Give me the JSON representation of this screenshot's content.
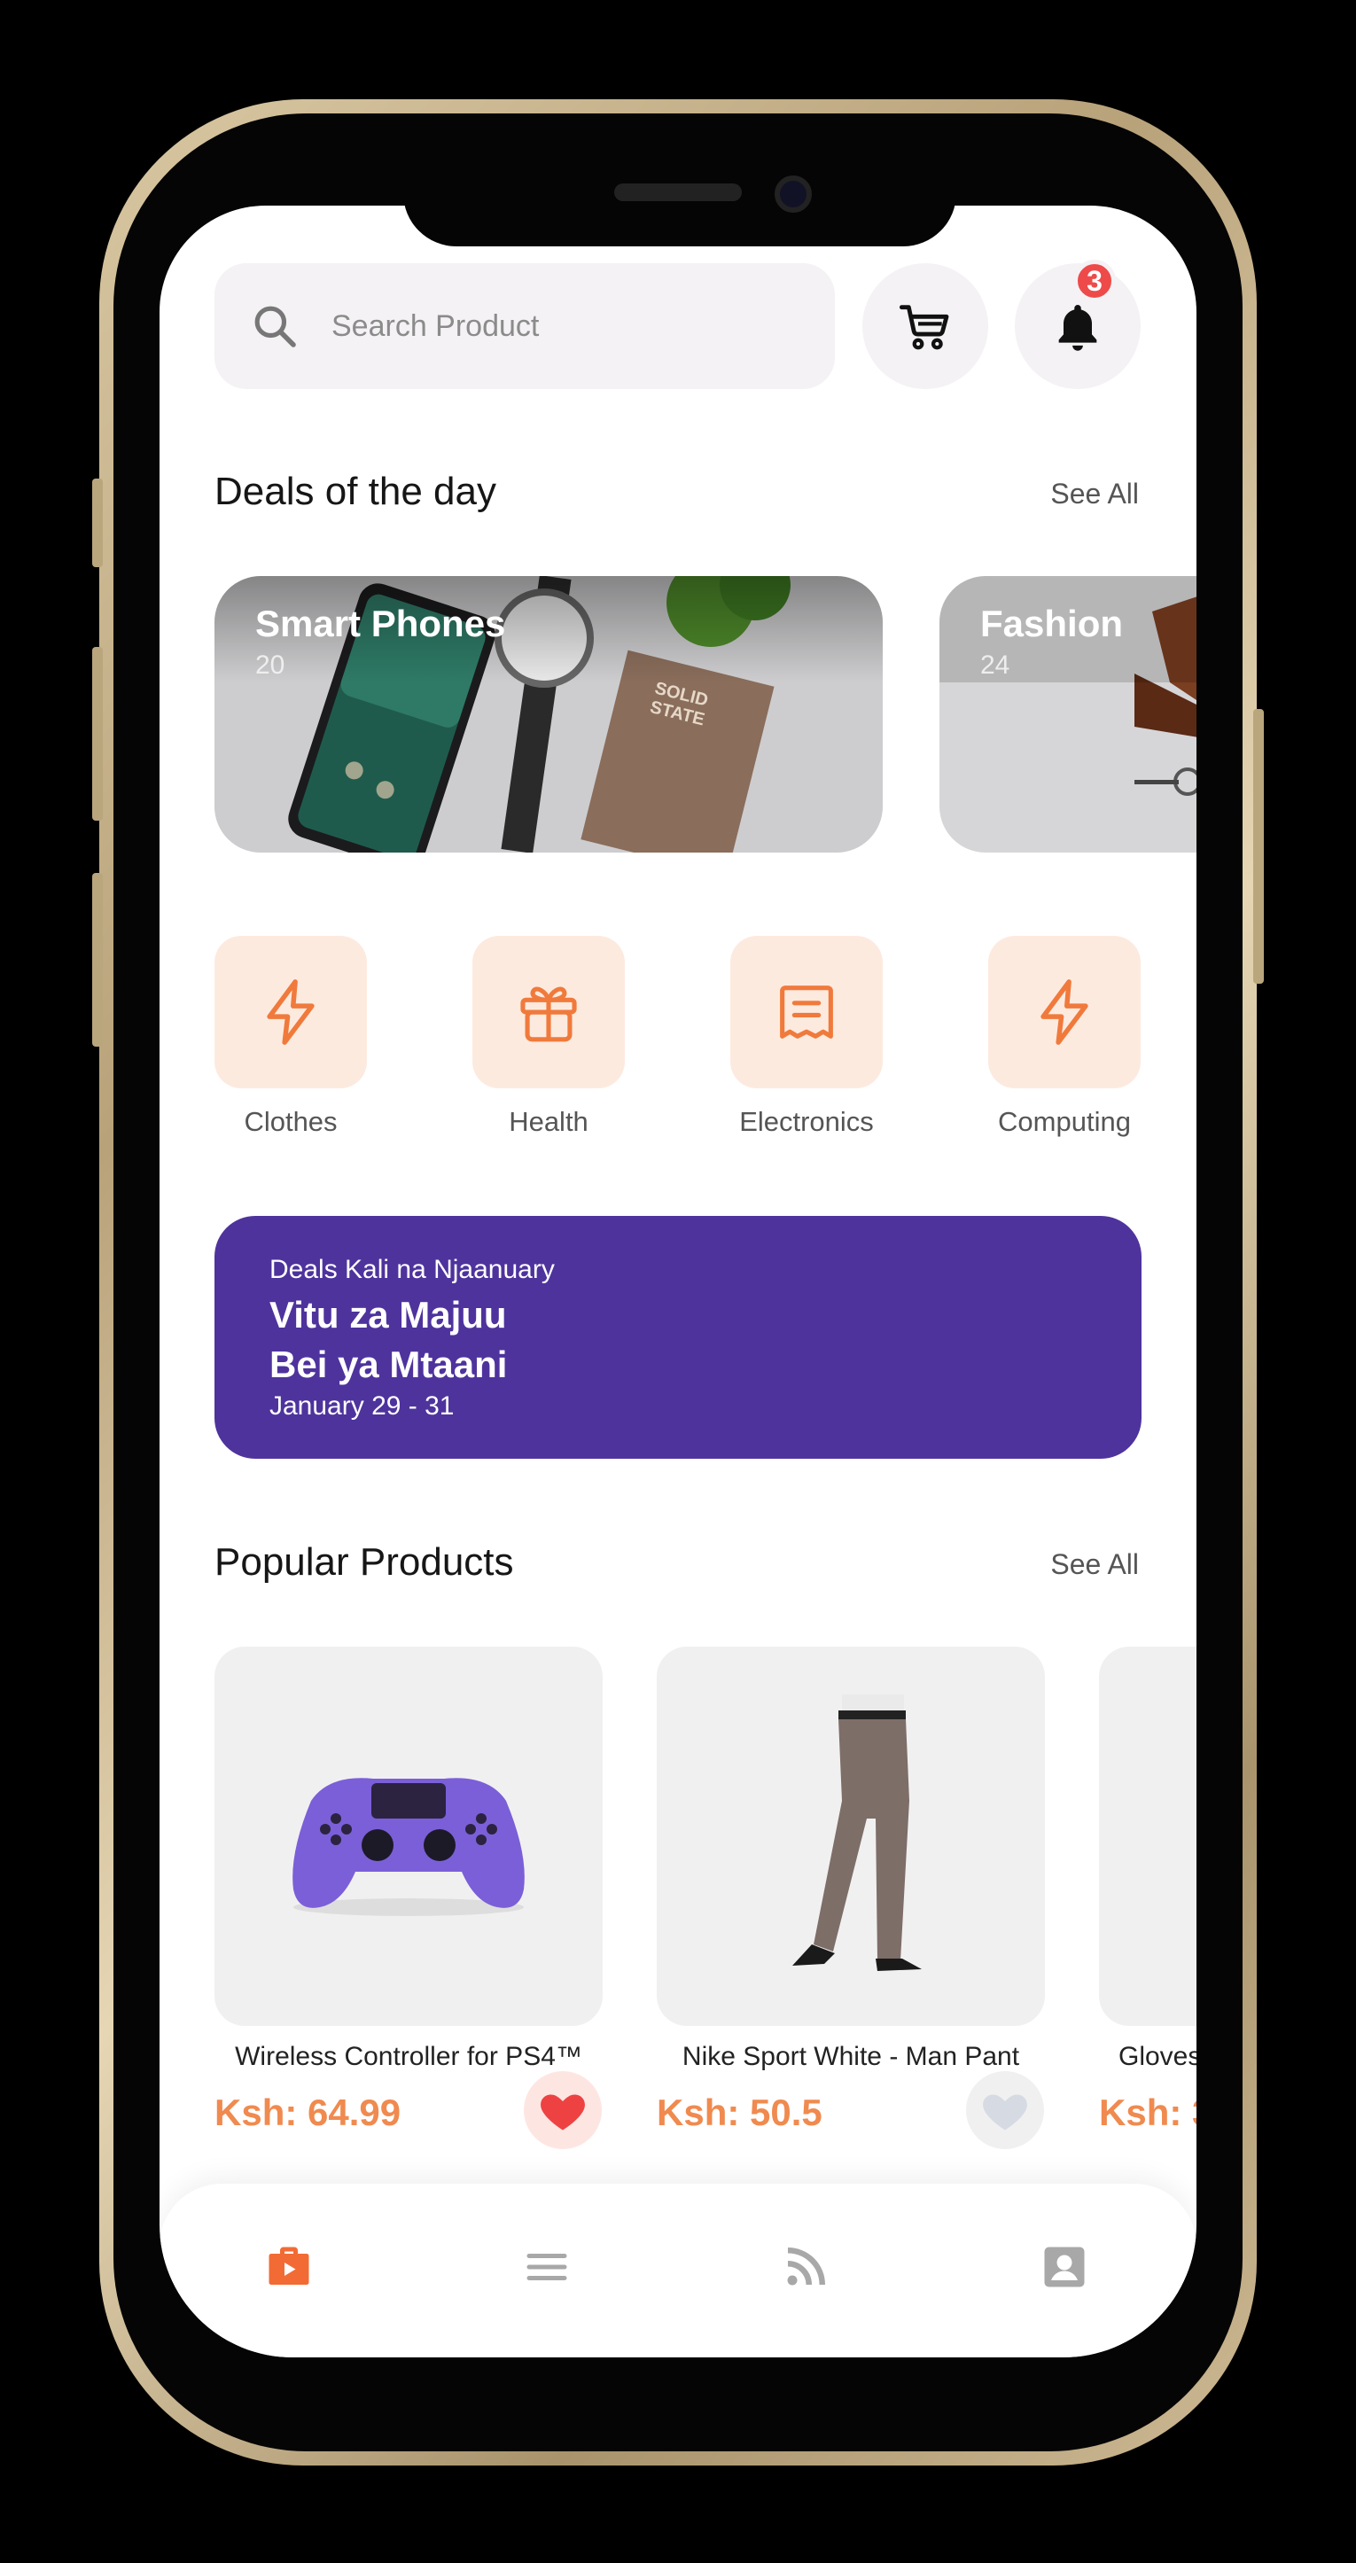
{
  "search": {
    "placeholder": "Search Product"
  },
  "notifications": {
    "badge_count": "3"
  },
  "deals": {
    "title": "Deals of the day",
    "see_all": "See All",
    "cards": [
      {
        "title": "Smart Phones",
        "count": "20"
      },
      {
        "title": "Fashion",
        "count": "24"
      }
    ]
  },
  "categories": [
    {
      "label": "Clothes",
      "icon": "flash-icon"
    },
    {
      "label": "Health",
      "icon": "gift-icon"
    },
    {
      "label": "Electronics",
      "icon": "receipt-icon"
    },
    {
      "label": "Computing",
      "icon": "flash-icon"
    }
  ],
  "promo": {
    "subtitle": "Deals Kali na Njaanuary",
    "line1": "Vitu za Majuu",
    "line2": "Bei ya Mtaani",
    "date": "January 29 - 31"
  },
  "popular": {
    "title": "Popular Products",
    "see_all": "See All",
    "products": [
      {
        "name": "Wireless Controller for PS4™",
        "price": "Ksh: 64.99",
        "favorited": true
      },
      {
        "name": "Nike Sport White - Man Pant",
        "price": "Ksh: 50.5",
        "favorited": false
      },
      {
        "name": "Gloves",
        "price": "Ksh: 3"
      }
    ]
  },
  "bottom_nav": {
    "items": [
      "shop-icon",
      "menu-icon",
      "rss-icon",
      "profile-icon"
    ],
    "active_color": "#f26b35",
    "inactive_color": "#a8a8a8"
  },
  "colors": {
    "accent": "#f08a4f",
    "promo_bg": "#4e339d",
    "category_bg": "#fdeadf",
    "badge": "#ee4a4a"
  }
}
